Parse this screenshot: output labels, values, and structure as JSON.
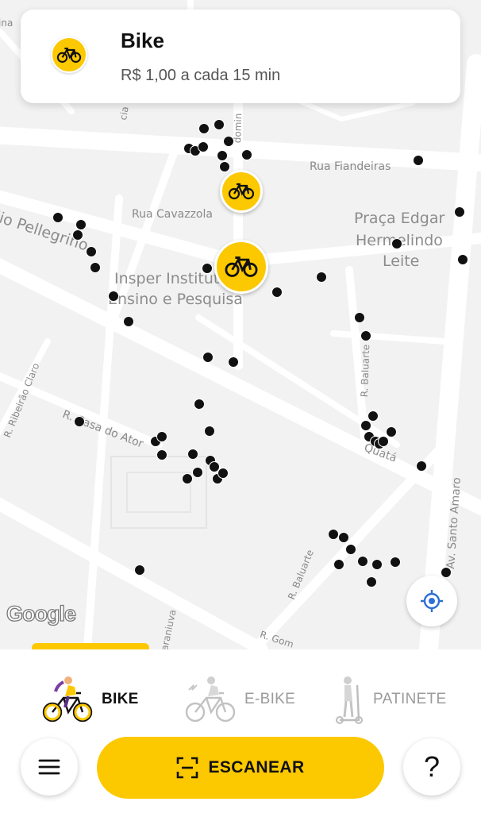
{
  "info_card": {
    "title": "Bike",
    "price": "R$ 1,00 a cada 15 min",
    "icon": "bike-icon"
  },
  "map": {
    "labels": {
      "rua_fiandeiras": "Rua Fiandeiras",
      "rua_cavazzola": "Rua Cavazzola",
      "pellegrino": "lio Pellegrino",
      "praca_line1": "Praça Edgar",
      "praca_line2": "Hermelindo",
      "praca_line3": "Leite",
      "insper_line1": "Insper Institut",
      "insper_line2": "Ensino e Pesquisa",
      "r_baluarte_1": "R. Baluarte",
      "r_baluarte_2": "R. Baluarte",
      "r_ribeirao": "R. Ribeirão Claro",
      "r_casa_ator": "R. Casa do Ator",
      "quata": "Quatá",
      "av_santo_amaro": "Av. Santo Amaro",
      "r_gomes": "R. Gom",
      "araniuva": "araniuva",
      "top_left": "ina",
      "domin": "domin",
      "cia": "cia"
    },
    "google_logo": "Google",
    "locate_icon": "crosshair-icon"
  },
  "vehicle_tabs": [
    {
      "label": "BIKE",
      "active": true,
      "icon": "bike-rider-icon"
    },
    {
      "label": "E-BIKE",
      "active": false,
      "icon": "ebike-rider-icon"
    },
    {
      "label": "PATINETE",
      "active": false,
      "icon": "scooter-rider-icon"
    }
  ],
  "actions": {
    "scan_label": "ESCANEAR",
    "scan_icon": "scan-icon",
    "menu_icon": "menu-icon",
    "help_label": "?"
  },
  "colors": {
    "accent": "#fcc800",
    "map_bg": "#f2f2f2",
    "road": "#ffffff",
    "marker": "#111111"
  }
}
